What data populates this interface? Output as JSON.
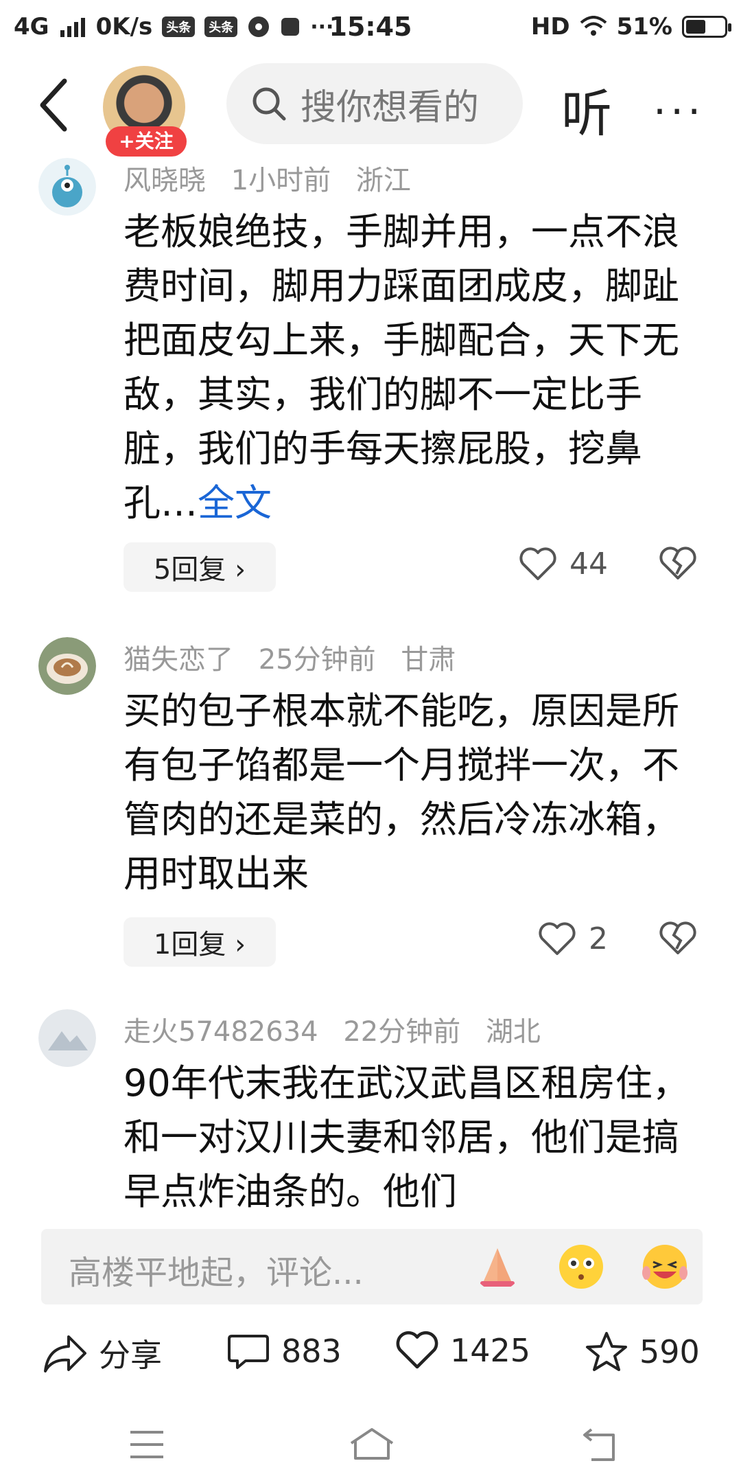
{
  "status_bar": {
    "network": "4G",
    "speed": "0K/s",
    "badge_1": "头条",
    "badge_2": "头条",
    "time": "15:45",
    "hd": "HD",
    "battery": "51%",
    "battery_level": 0.51
  },
  "header": {
    "follow_label": "+关注",
    "search_placeholder": "搜你想看的",
    "listen_label": "听",
    "more_label": "···"
  },
  "comments": [
    {
      "username": "风晓晓",
      "time": "1小时前",
      "location": "浙江",
      "text": "老板娘绝技，手脚并用，一点不浪费时间，脚用力踩面团成皮，脚趾把面皮勾上来，手脚配合，天下无敌，其实，我们的脚不一定比手脏，我们的手每天擦屁股，挖鼻孔…",
      "full_text_link": "全文",
      "replies": "5回复 ›",
      "likes": "44"
    },
    {
      "username": "猫失恋了",
      "time": "25分钟前",
      "location": "甘肃",
      "text": "买的包子根本就不能吃，原因是所有包子馅都是一个月搅拌一次，不管肉的还是菜的，然后冷冻冰箱，用时取出来",
      "replies": "1回复 ›",
      "likes": "2"
    },
    {
      "username": "走火57482634",
      "time": "22分钟前",
      "location": "湖北",
      "text": "90年代末我在武汉武昌区租房住，和一对汉川夫妻和邻居，他们是搞早点炸油条的。他们"
    }
  ],
  "comment_bar": {
    "placeholder": "高楼平地起，评论..."
  },
  "actions": {
    "share_label": "分享",
    "comments_count": "883",
    "likes_count": "1425",
    "favorites_count": "590"
  },
  "colors": {
    "accent_red": "#f04142",
    "link_blue": "#1a66d6",
    "meta_gray": "#999999"
  }
}
